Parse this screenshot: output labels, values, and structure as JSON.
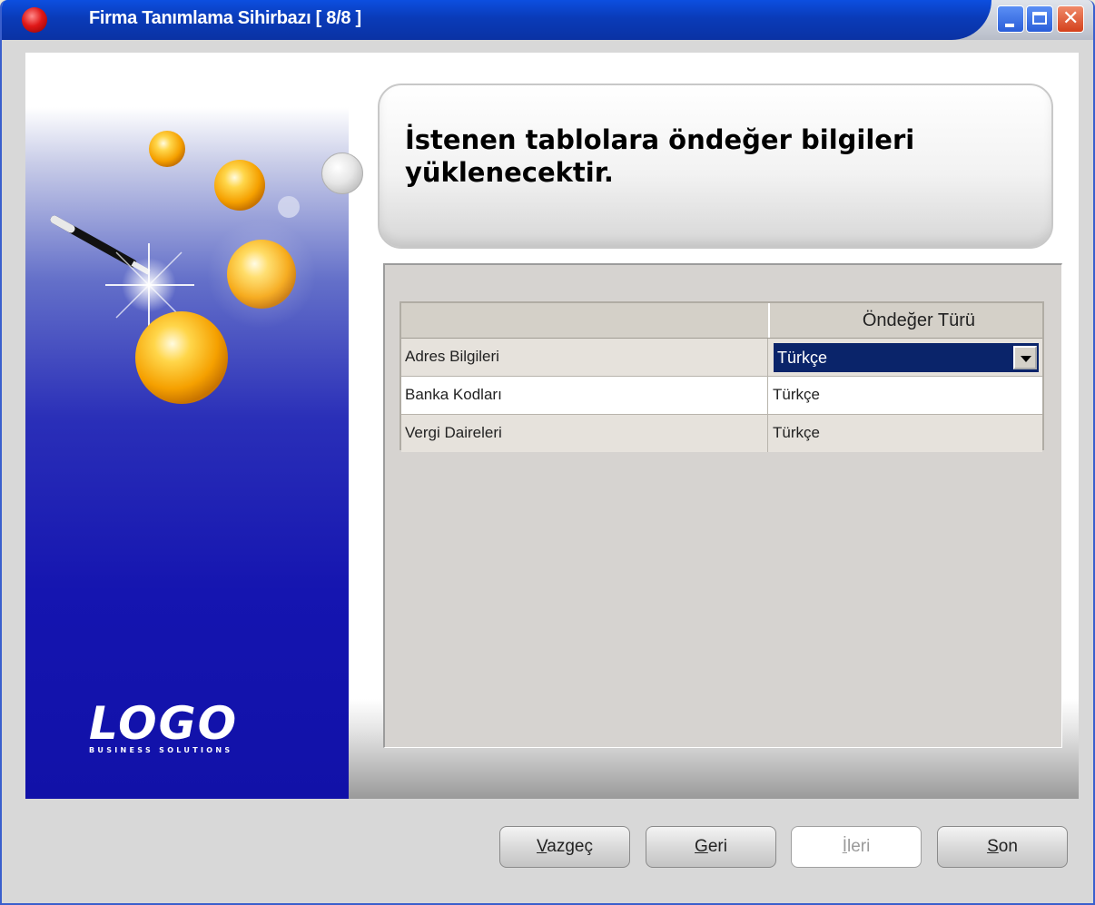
{
  "window": {
    "title": "Firma Tanımlama Sihirbazı [ 8/8 ]",
    "controls": [
      "minimize-icon",
      "maximize-icon",
      "close-icon"
    ]
  },
  "banner": {
    "logo_text": "LOGO",
    "logo_subtext": "BUSINESS SOLUTIONS"
  },
  "heading": "İstenen tablolara öndeğer bilgileri yüklenecektir.",
  "grid": {
    "columns": [
      "",
      "Öndeğer Türü"
    ],
    "rows": [
      {
        "name": "Adres Bilgileri",
        "value": "Türkçe"
      },
      {
        "name": "Banka Kodları",
        "value": "Türkçe"
      },
      {
        "name": "Vergi Daireleri",
        "value": "Türkçe"
      }
    ]
  },
  "buttons": {
    "cancel": {
      "first": "V",
      "rest": "azgeç"
    },
    "back": {
      "first": "G",
      "rest": "eri"
    },
    "next": {
      "first": "İ",
      "rest": "leri"
    },
    "finish": {
      "first": "S",
      "rest": "on"
    }
  },
  "colors": {
    "titlebar": "#0a3bb8",
    "selection": "#0a246a",
    "banner": "#1515b0"
  }
}
